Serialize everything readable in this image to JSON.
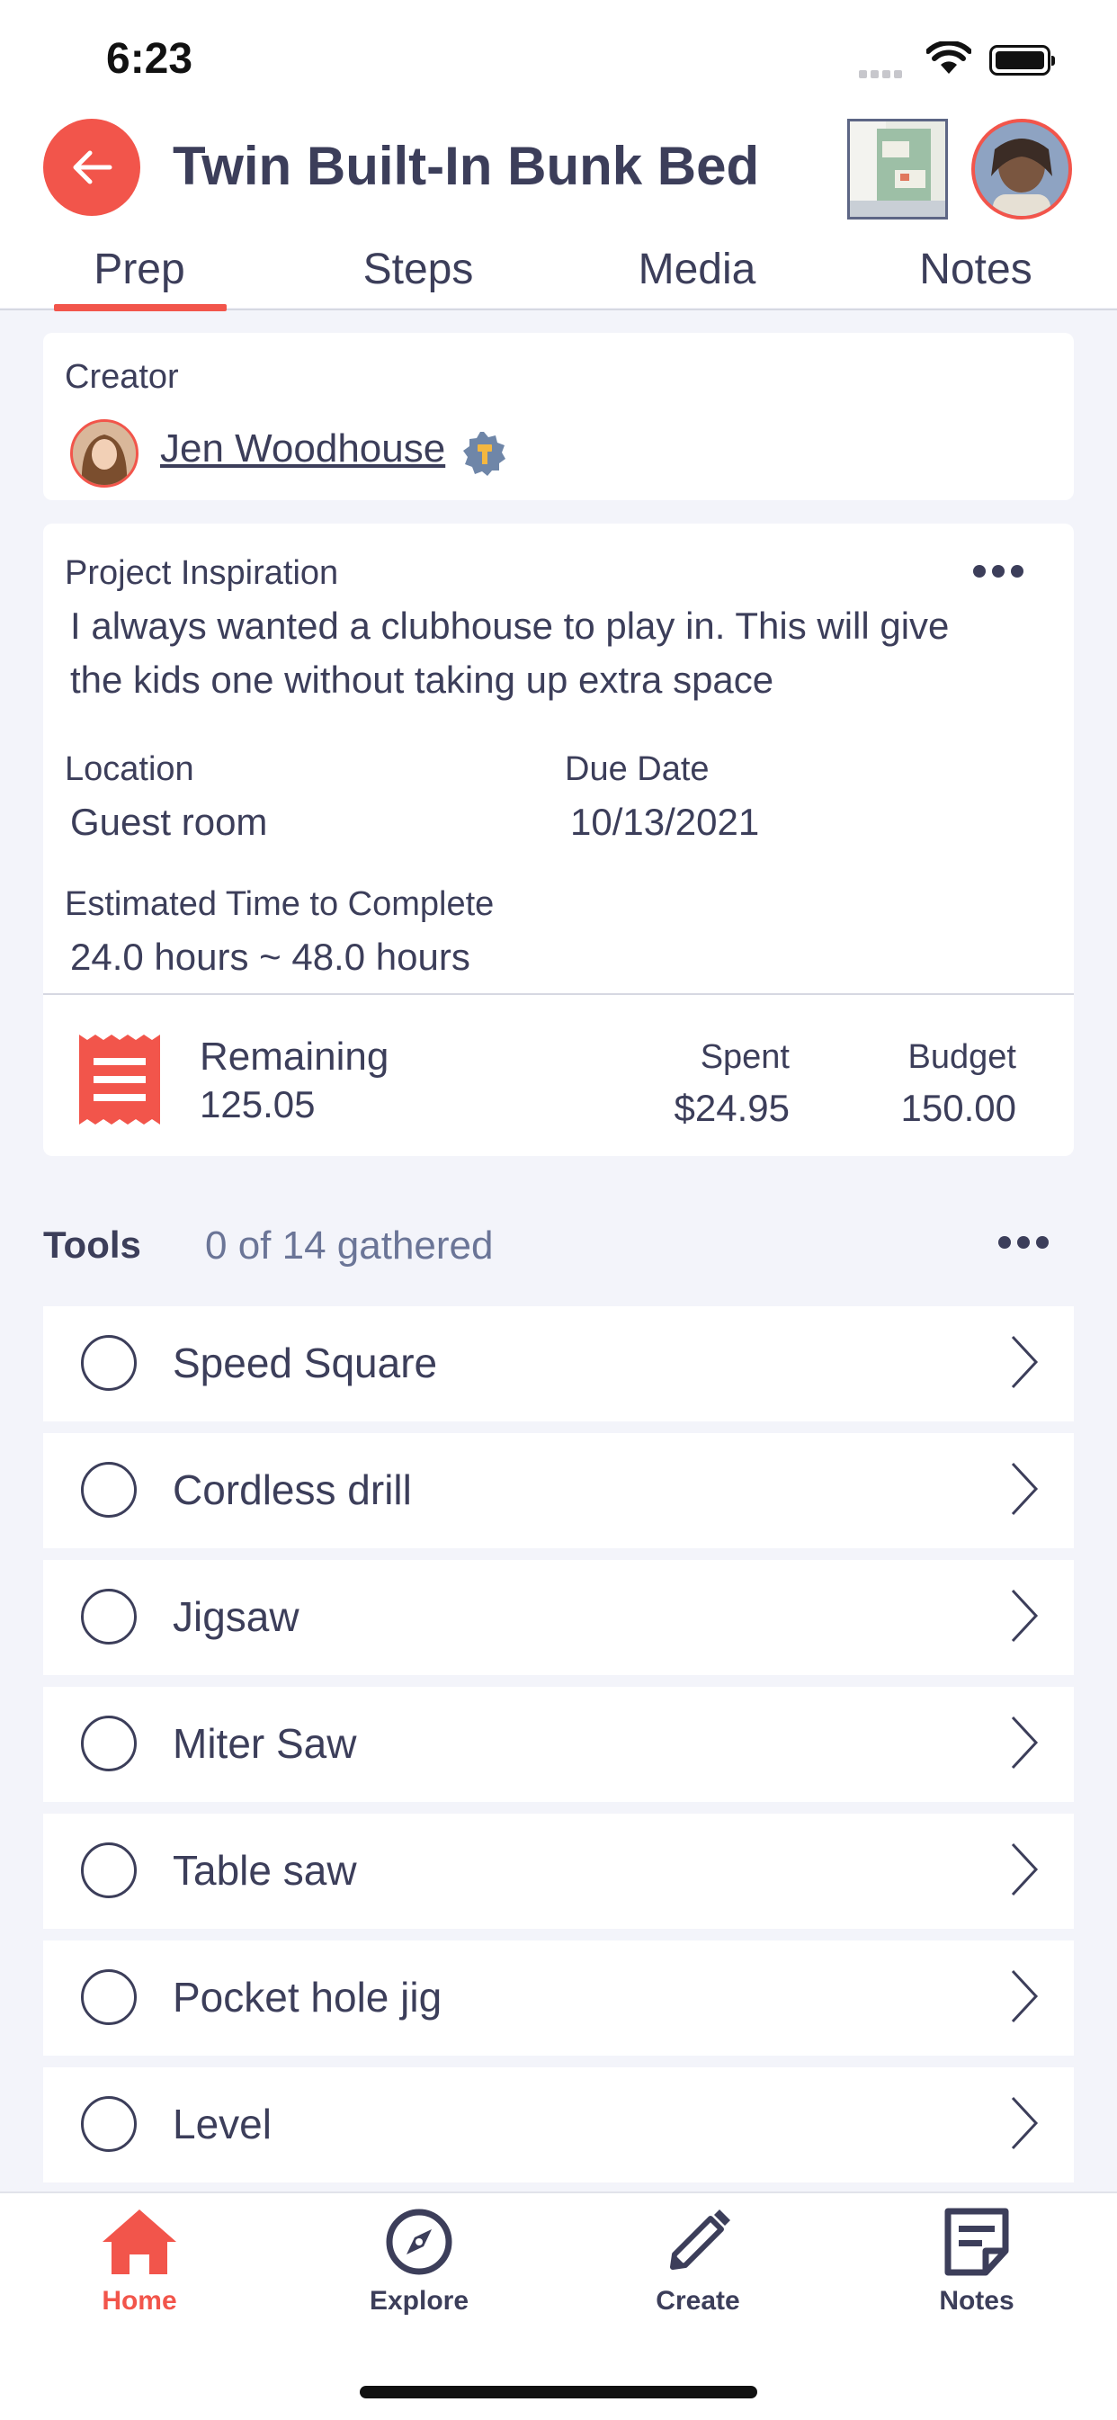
{
  "status_bar": {
    "time": "6:23"
  },
  "header": {
    "title": "Twin Built-In Bunk Bed"
  },
  "tabs": [
    {
      "label": "Prep",
      "active": true
    },
    {
      "label": "Steps"
    },
    {
      "label": "Media"
    },
    {
      "label": "Notes"
    }
  ],
  "creator": {
    "label": "Creator",
    "name": "Jen Woodhouse"
  },
  "inspiration": {
    "label": "Project Inspiration",
    "text_line1": "I always wanted a clubhouse to play in. This will give",
    "text_line2": "the kids one without taking up extra space"
  },
  "location": {
    "label": "Location",
    "value": "Guest room"
  },
  "due_date": {
    "label": "Due Date",
    "value": "10/13/2021"
  },
  "estimated_time": {
    "label": "Estimated Time to Complete",
    "value": "24.0 hours ~ 48.0 hours"
  },
  "budget": {
    "remaining_label": "Remaining",
    "remaining_value": "125.05",
    "spent_label": "Spent",
    "spent_value": "$24.95",
    "budget_label": "Budget",
    "budget_value": "150.00"
  },
  "tools": {
    "title": "Tools",
    "count_text": "0 of 14 gathered",
    "items": [
      "Speed Square",
      "Cordless drill",
      "Jigsaw",
      "Miter Saw",
      "Table saw",
      "Pocket hole jig",
      "Level"
    ]
  },
  "bottom_nav": [
    {
      "label": "Home",
      "icon": "home-icon",
      "active": true
    },
    {
      "label": "Explore",
      "icon": "compass-icon"
    },
    {
      "label": "Create",
      "icon": "pencil-icon"
    },
    {
      "label": "Notes",
      "icon": "notes-icon"
    }
  ],
  "colors": {
    "accent": "#f2554b",
    "text": "#3c3e5a",
    "muted": "#6b7597",
    "background": "#f3f4fa"
  }
}
